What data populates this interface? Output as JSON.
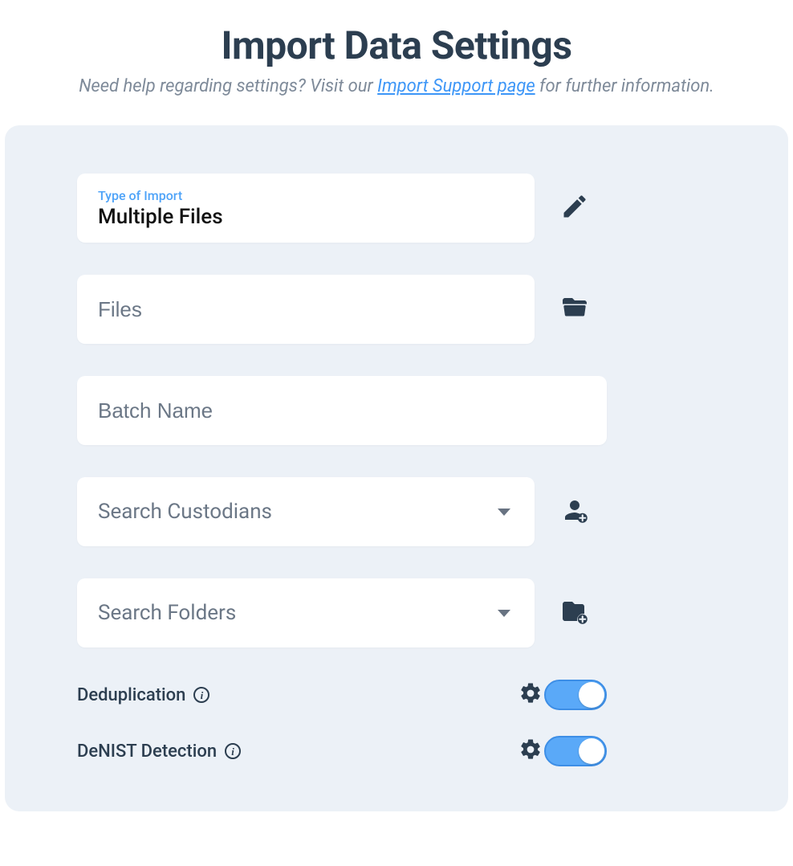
{
  "header": {
    "title": "Import Data Settings",
    "subtitle_prefix": "Need help regarding settings? Visit our ",
    "subtitle_link": "Import Support page",
    "subtitle_suffix": " for further information."
  },
  "form": {
    "import_type": {
      "label": "Type of Import",
      "value": "Multiple Files"
    },
    "files": {
      "placeholder": "Files"
    },
    "batch_name": {
      "placeholder": "Batch Name"
    },
    "custodians": {
      "placeholder": "Search Custodians"
    },
    "folders": {
      "placeholder": "Search Folders"
    },
    "dedup": {
      "label": "Deduplication",
      "enabled": true
    },
    "denist": {
      "label": "DeNIST Detection",
      "enabled": true
    }
  }
}
